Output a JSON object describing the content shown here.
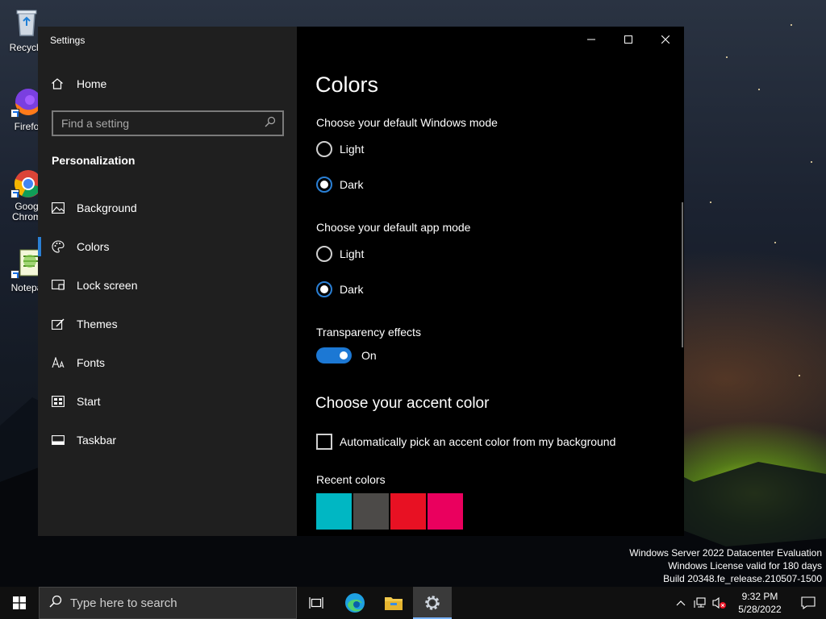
{
  "desktop": {
    "icons": [
      {
        "label": "Recycle",
        "icon": "recycle-bin-icon"
      },
      {
        "label": "Firefo",
        "icon": "firefox-icon"
      },
      {
        "label": "Goog Chrom",
        "icon": "chrome-icon"
      },
      {
        "label": "Notepa",
        "icon": "notepad-icon"
      }
    ],
    "watermark": {
      "line1": "Windows Server 2022 Datacenter Evaluation",
      "line2": "Windows License valid for 180 days",
      "line3": "Build 20348.fe_release.210507-1500"
    }
  },
  "window": {
    "title": "Settings",
    "nav": {
      "home_label": "Home",
      "search_placeholder": "Find a setting",
      "section": "Personalization",
      "items": [
        {
          "label": "Background",
          "icon": "background-icon"
        },
        {
          "label": "Colors",
          "icon": "palette-icon",
          "active": true
        },
        {
          "label": "Lock screen",
          "icon": "lock-screen-icon"
        },
        {
          "label": "Themes",
          "icon": "themes-icon"
        },
        {
          "label": "Fonts",
          "icon": "fonts-icon"
        },
        {
          "label": "Start",
          "icon": "start-icon"
        },
        {
          "label": "Taskbar",
          "icon": "taskbar-icon"
        }
      ]
    },
    "content": {
      "title": "Colors",
      "windows_mode": {
        "label": "Choose your default Windows mode",
        "options": [
          "Light",
          "Dark"
        ],
        "selected": "Dark"
      },
      "app_mode": {
        "label": "Choose your default app mode",
        "options": [
          "Light",
          "Dark"
        ],
        "selected": "Dark"
      },
      "transparency": {
        "label": "Transparency effects",
        "state": "On"
      },
      "accent": {
        "title": "Choose your accent color",
        "auto_pick_label": "Automatically pick an accent color from my background",
        "recent_label": "Recent colors",
        "recent_colors": [
          "#00b7c3",
          "#4c4a48",
          "#e81123",
          "#ea005e"
        ]
      }
    }
  },
  "taskbar": {
    "search_placeholder": "Type here to search",
    "apps": [
      {
        "icon": "task-view-icon"
      },
      {
        "icon": "edge-icon"
      },
      {
        "icon": "file-explorer-icon"
      },
      {
        "icon": "settings-gear-icon",
        "active": true
      }
    ],
    "time": "9:32 PM",
    "date": "5/28/2022"
  },
  "colors": {
    "accent": "#2a7fd4",
    "nav_bg": "#1f1f1f",
    "content_bg": "#000000"
  }
}
